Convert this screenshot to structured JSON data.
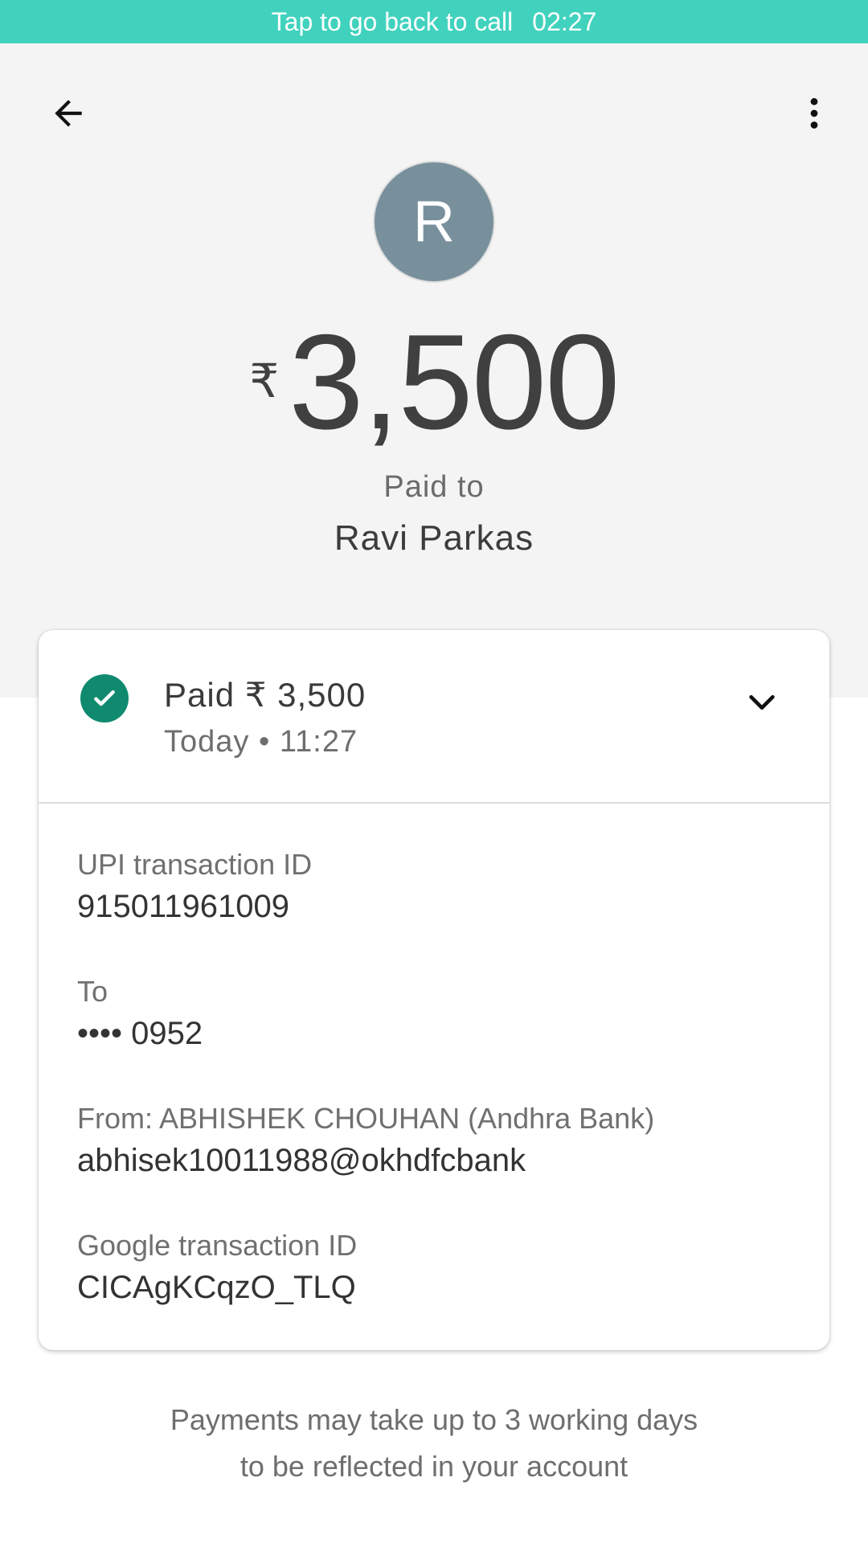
{
  "call_bar": {
    "text": "Tap to go back to call",
    "time": "02:27",
    "color": "#41d2be"
  },
  "toolbar": {
    "back_icon": "arrow-back-icon",
    "more_icon": "more-vert-icon"
  },
  "payee": {
    "avatar_initial": "R",
    "avatar_color": "#78909c",
    "currency_symbol": "₹",
    "amount": "3,500",
    "paid_to_label": "Paid to",
    "name": "Ravi Parkas"
  },
  "status": {
    "icon": "check-circle-icon",
    "icon_color": "#0f8a6f",
    "title": "Paid ₹ 3,500",
    "timestamp": "Today • 11:27",
    "expand_icon": "chevron-down-icon"
  },
  "details": {
    "upi_id_label": "UPI transaction ID",
    "upi_id_value": "915011961009",
    "to_label": "To",
    "to_value": "•••• 0952",
    "from_label": "From: ABHISHEK CHOUHAN (Andhra Bank)",
    "from_value": "abhisek10011988@okhdfcbank",
    "google_id_label": "Google transaction ID",
    "google_id_value": "CICAgKCqzO_TLQ"
  },
  "footer": {
    "line1": "Payments may take up to 3 working days",
    "line2": "to be reflected in your account"
  }
}
